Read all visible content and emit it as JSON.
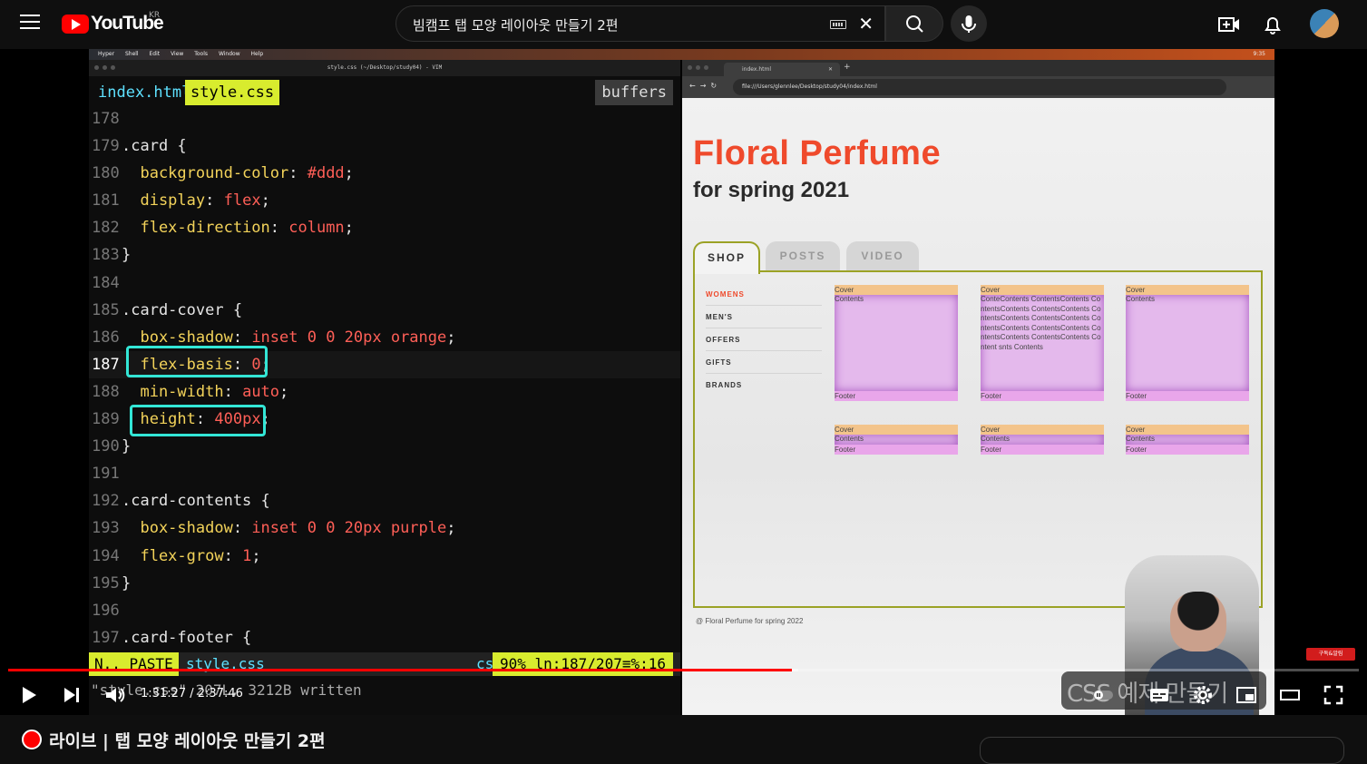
{
  "header": {
    "logo_text": "YouTube",
    "country": "KR",
    "search_value": "빔캠프 탭 모양 레이아웃 만들기 2편",
    "icons": [
      "menu-icon",
      "keyboard-icon",
      "clear-icon",
      "search-icon",
      "mic-icon",
      "create-icon",
      "bell-icon"
    ]
  },
  "mac_menubar": {
    "items": [
      "Hyper",
      "Shell",
      "Edit",
      "View",
      "Tools",
      "Window",
      "Help"
    ],
    "time": "9:35"
  },
  "vim": {
    "window_title": "style.css (~/Desktop/study04) - VIM",
    "tabs": [
      "index.html",
      "style.css"
    ],
    "buffers_label": "buffers",
    "lines": [
      {
        "n": "178",
        "parts": []
      },
      {
        "n": "179",
        "parts": [
          {
            "t": ".card {",
            "c": "sel"
          }
        ]
      },
      {
        "n": "180",
        "parts": [
          {
            "t": "  background-color",
            "c": "prop"
          },
          {
            "t": ": ",
            "c": "sel"
          },
          {
            "t": "#ddd",
            "c": "val"
          },
          {
            "t": ";",
            "c": "sel"
          }
        ]
      },
      {
        "n": "181",
        "parts": [
          {
            "t": "  display",
            "c": "prop"
          },
          {
            "t": ": ",
            "c": "sel"
          },
          {
            "t": "flex",
            "c": "val"
          },
          {
            "t": ";",
            "c": "sel"
          }
        ]
      },
      {
        "n": "182",
        "parts": [
          {
            "t": "  flex-direction",
            "c": "prop"
          },
          {
            "t": ": ",
            "c": "sel"
          },
          {
            "t": "column",
            "c": "val"
          },
          {
            "t": ";",
            "c": "sel"
          }
        ]
      },
      {
        "n": "183",
        "parts": [
          {
            "t": "}",
            "c": "sel"
          }
        ]
      },
      {
        "n": "184",
        "parts": []
      },
      {
        "n": "185",
        "parts": [
          {
            "t": ".card-cover {",
            "c": "sel"
          }
        ]
      },
      {
        "n": "186",
        "parts": [
          {
            "t": "  box-shadow",
            "c": "prop"
          },
          {
            "t": ": ",
            "c": "sel"
          },
          {
            "t": "inset 0 0 20px orange",
            "c": "val"
          },
          {
            "t": ";",
            "c": "sel"
          }
        ]
      },
      {
        "n": "187",
        "parts": [
          {
            "t": "  flex-basis",
            "c": "prop"
          },
          {
            "t": ": ",
            "c": "sel"
          },
          {
            "t": "0",
            "c": "val"
          },
          {
            "t": ";",
            "c": "sel"
          }
        ],
        "cursor": true
      },
      {
        "n": "188",
        "parts": [
          {
            "t": "  min-width",
            "c": "prop"
          },
          {
            "t": ": ",
            "c": "sel"
          },
          {
            "t": "auto",
            "c": "val"
          },
          {
            "t": ";",
            "c": "sel"
          }
        ]
      },
      {
        "n": "189",
        "parts": [
          {
            "t": "  height",
            "c": "prop"
          },
          {
            "t": ": ",
            "c": "sel"
          },
          {
            "t": "400px",
            "c": "val"
          },
          {
            "t": ";",
            "c": "sel"
          }
        ]
      },
      {
        "n": "190",
        "parts": [
          {
            "t": "}",
            "c": "sel"
          }
        ]
      },
      {
        "n": "191",
        "parts": []
      },
      {
        "n": "192",
        "parts": [
          {
            "t": ".card-contents {",
            "c": "sel"
          }
        ]
      },
      {
        "n": "193",
        "parts": [
          {
            "t": "  box-shadow",
            "c": "prop"
          },
          {
            "t": ": ",
            "c": "sel"
          },
          {
            "t": "inset 0 0 20px purple",
            "c": "val"
          },
          {
            "t": ";",
            "c": "sel"
          }
        ]
      },
      {
        "n": "194",
        "parts": [
          {
            "t": "  flex-grow",
            "c": "prop"
          },
          {
            "t": ": ",
            "c": "sel"
          },
          {
            "t": "1",
            "c": "val"
          },
          {
            "t": ";",
            "c": "sel"
          }
        ]
      },
      {
        "n": "195",
        "parts": [
          {
            "t": "}",
            "c": "sel"
          }
        ]
      },
      {
        "n": "196",
        "parts": []
      },
      {
        "n": "197",
        "parts": [
          {
            "t": ".card-footer {",
            "c": "sel"
          }
        ]
      }
    ],
    "status": {
      "mode": "N.. PASTE",
      "file": "style.css",
      "filetype": "css",
      "position": "90% ln:187/207≡%:16"
    },
    "cmdline": "\"style.css\" 207L, 3212B written"
  },
  "browser": {
    "tab_title": "index.html",
    "url": "file:///Users/glennlee/Desktop/study04/index.html",
    "page": {
      "title": "Floral Perfume",
      "subtitle": "for spring 2021",
      "tabs": [
        "SHOP",
        "POSTS",
        "VIDEO"
      ],
      "active_tab": "SHOP",
      "sidebar": [
        "WOMENS",
        "MEN'S",
        "OFFERS",
        "GIFTS",
        "BRANDS"
      ],
      "active_sidebar": "WOMENS",
      "cards": [
        {
          "cover": "Cover",
          "contents": "Contents",
          "footer": "Footer"
        },
        {
          "cover": "Cover",
          "contents": "ConteContents ContentsContents ContentsContents ContentsContents ContentsContents ContentsContents ContentsContents ContentsContents ContentsContents ContentsContents Content snts Contents",
          "footer": "Footer"
        },
        {
          "cover": "Cover",
          "contents": "Contents",
          "footer": "Footer"
        },
        {
          "cover": "Cover",
          "contents": "Contents",
          "footer": "Footer"
        },
        {
          "cover": "Cover",
          "contents": "Contents",
          "footer": "Footer"
        },
        {
          "cover": "Cover",
          "contents": "Contents",
          "footer": "Footer"
        }
      ],
      "footer": "@ Floral Perfume for spring 2022"
    }
  },
  "player": {
    "time_current": "1:31:27",
    "time_total": "2:37:46",
    "progress": 0.58,
    "buffered": 0.585,
    "chapter_overlay": "CSS 예제 만들기",
    "subscribe_badge": "구독&알림",
    "controls": [
      "play-icon",
      "next-icon",
      "volume-icon",
      "autoplay-icon",
      "subtitles-icon",
      "settings-icon",
      "miniplayer-icon",
      "theater-icon",
      "fullscreen-icon"
    ]
  },
  "video": {
    "title": "라이브 | 탭 모양 레이아웃 만들기 2편"
  },
  "colors": {
    "youtube_red": "#ff0000",
    "vim_accent": "#d8ec2e",
    "vim_tab_text": "#5ee1ff",
    "css_value": "#ff5f57",
    "css_property": "#f3d35a",
    "highlight_box": "#33e6d6",
    "fp_title": "#ef4a2c",
    "fp_border": "#9ba226"
  }
}
